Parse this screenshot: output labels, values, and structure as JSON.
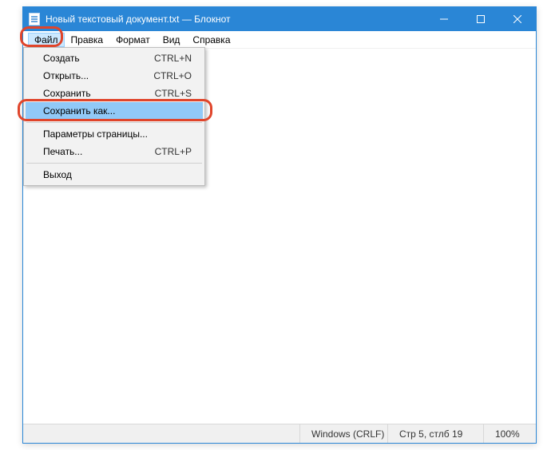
{
  "title": "Новый текстовый документ.txt — Блокнот",
  "menubar": {
    "file": "Файл",
    "edit": "Правка",
    "format": "Формат",
    "view": "Вид",
    "help": "Справка"
  },
  "file_menu": {
    "new": {
      "label": "Создать",
      "shortcut": "CTRL+N"
    },
    "open": {
      "label": "Открыть...",
      "shortcut": "CTRL+O"
    },
    "save": {
      "label": "Сохранить",
      "shortcut": "CTRL+S"
    },
    "save_as": {
      "label": "Сохранить как...",
      "shortcut": ""
    },
    "page_setup": {
      "label": "Параметры страницы...",
      "shortcut": ""
    },
    "print": {
      "label": "Печать...",
      "shortcut": "CTRL+P"
    },
    "exit": {
      "label": "Выход",
      "shortcut": ""
    }
  },
  "statusbar": {
    "line_ending": "Windows (CRLF)",
    "position": "Стр 5, стлб 19",
    "zoom": "100%"
  }
}
